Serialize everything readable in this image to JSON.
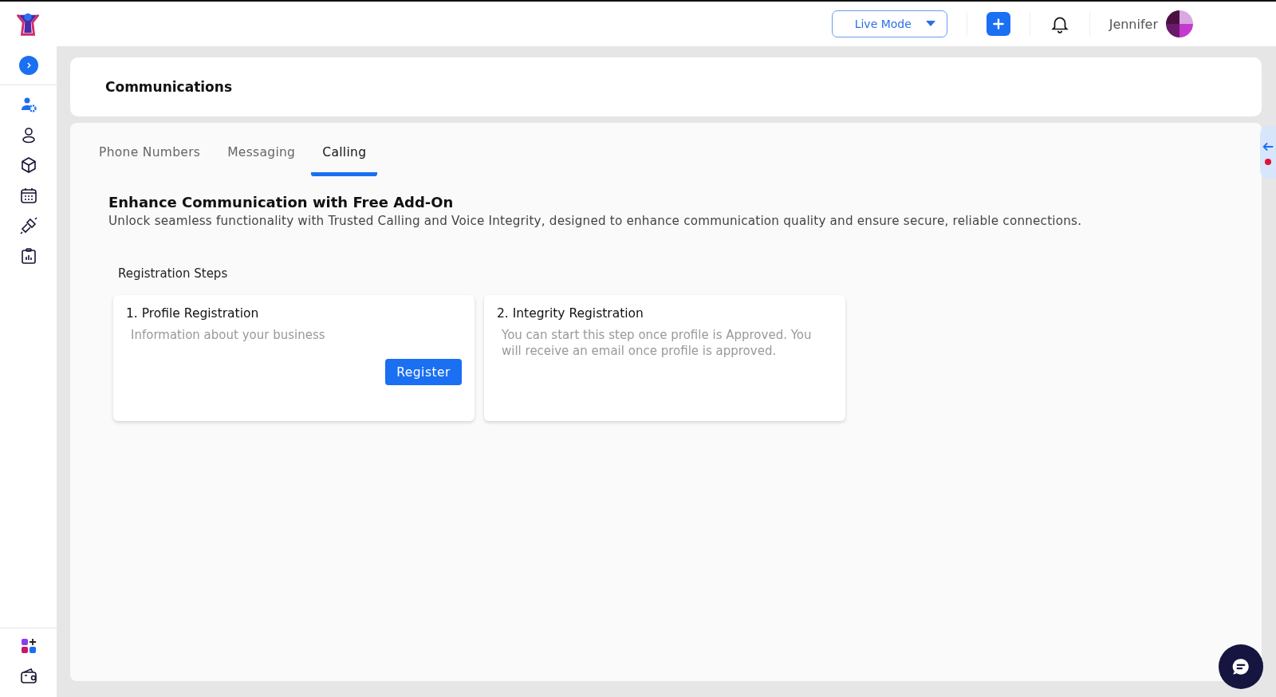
{
  "header": {
    "mode_select": {
      "value": "Live Mode"
    },
    "user_name": "Jennifer"
  },
  "sidebar": {
    "items": [
      {
        "selected": true
      },
      {
        "selected": false
      },
      {
        "selected": false
      },
      {
        "selected": false
      },
      {
        "selected": false
      },
      {
        "selected": false
      }
    ]
  },
  "page_title": "Communications",
  "tabs": [
    {
      "label": "Phone Numbers",
      "selected": false
    },
    {
      "label": "Messaging",
      "selected": false
    },
    {
      "label": "Calling",
      "selected": true
    }
  ],
  "intro": {
    "heading": "Enhance Communication with Free Add-On",
    "text": "Unlock seamless functionality with Trusted Calling and Voice Integrity, designed to enhance communication quality and ensure secure, reliable connections."
  },
  "steps_title": "Registration Steps",
  "steps": [
    {
      "title": "1. Profile Registration",
      "description": "Information about your business",
      "button": "Register"
    },
    {
      "title": "2. Integrity Registration",
      "description": "You can start this step once profile is Approved. You will receive an email once profile is approved."
    }
  ],
  "side_tab": {
    "alert": true
  }
}
